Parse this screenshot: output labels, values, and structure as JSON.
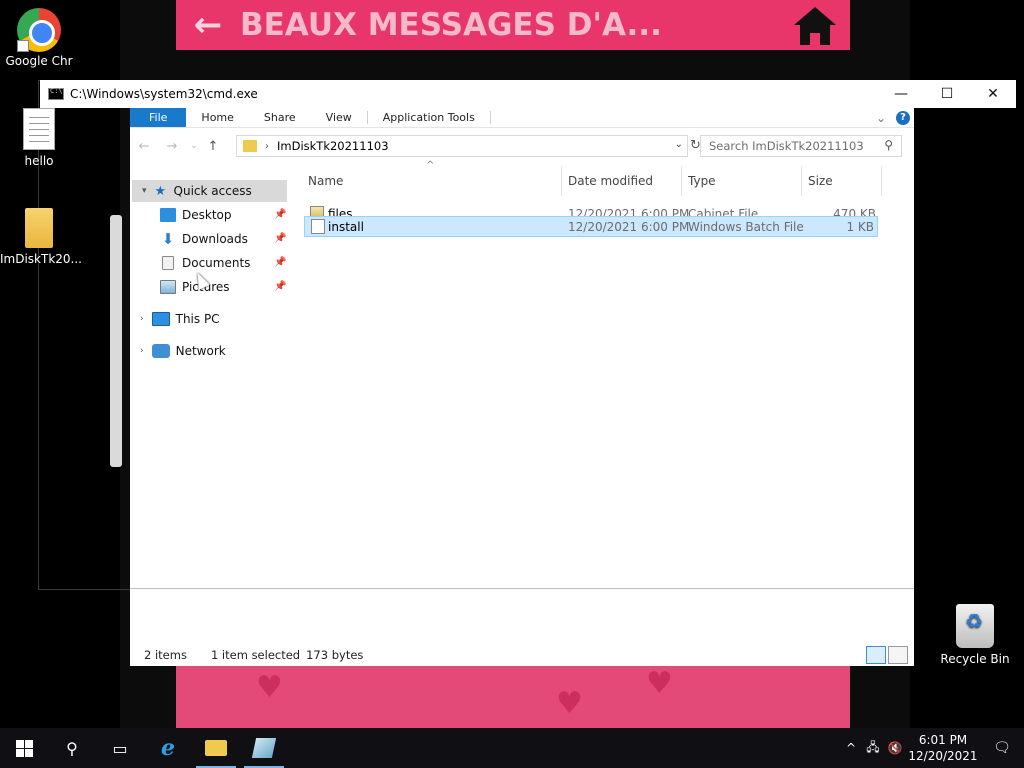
{
  "background": {
    "banner_text": "BEAUX MESSAGES D'A...",
    "colors": {
      "banner": "#e8366b",
      "bottom": "#e44a78"
    }
  },
  "desktop": {
    "icons": [
      {
        "label": "Google Chr",
        "icon": "chrome-icon"
      },
      {
        "label": "hello",
        "icon": "text-file-icon"
      },
      {
        "label": "ImDiskTk20...",
        "icon": "folder-icon"
      },
      {
        "label": "Recycle Bin",
        "icon": "recycle-bin-icon"
      }
    ]
  },
  "window": {
    "title": "C:\\Windows\\system32\\cmd.exe",
    "controls": {
      "minimize": "—",
      "maximize": "☐",
      "close": "✕"
    }
  },
  "ribbon": {
    "tabs": [
      "File",
      "Home",
      "Share",
      "View",
      "Application Tools"
    ],
    "help": "?"
  },
  "navigation": {
    "address": "ImDiskTk20211103",
    "search_placeholder": "Search ImDiskTk20211103"
  },
  "nav_pane": {
    "quick_access": "Quick access",
    "pinned": [
      "Desktop",
      "Downloads",
      "Documents",
      "Pictures"
    ],
    "this_pc": "This PC",
    "network": "Network"
  },
  "columns": [
    "Name",
    "Date modified",
    "Type",
    "Size"
  ],
  "files": [
    {
      "name": "files",
      "date": "12/20/2021 6:00 PM",
      "type": "Cabinet File",
      "size": "470 KB",
      "selected": false
    },
    {
      "name": "install",
      "date": "12/20/2021 6:00 PM",
      "type": "Windows Batch File",
      "size": "1 KB",
      "selected": true
    }
  ],
  "status": {
    "items": "2 items",
    "selected": "1 item selected",
    "bytes": "173 bytes"
  },
  "taskbar": {
    "time": "6:01 PM",
    "date": "12/20/2021"
  }
}
